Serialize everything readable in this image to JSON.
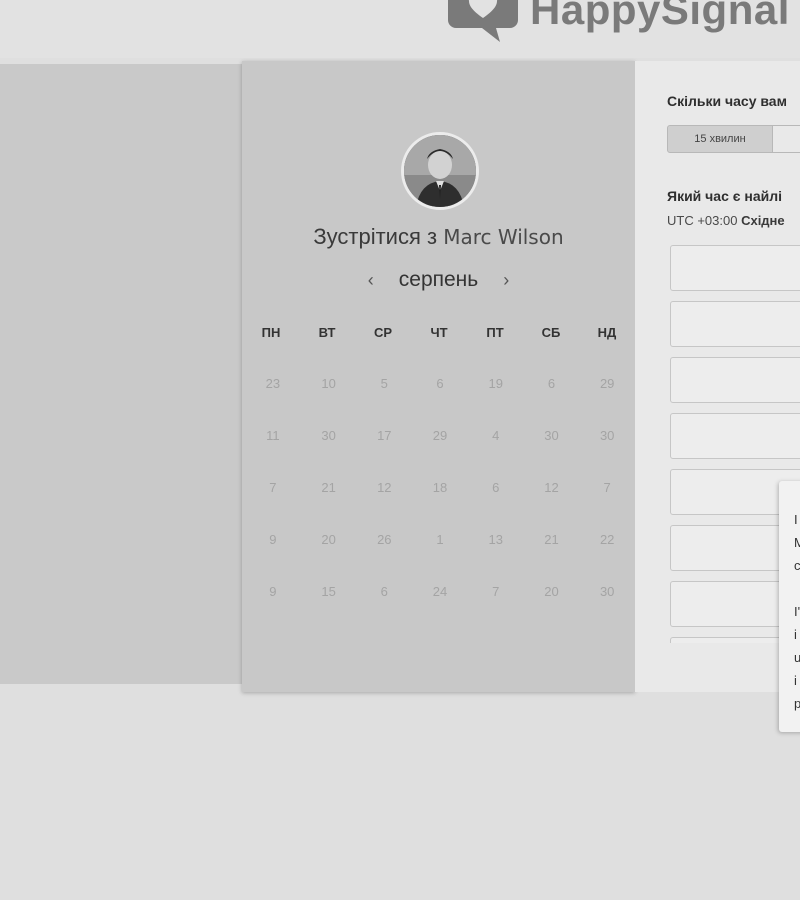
{
  "header": {
    "brand": "HappySignal",
    "logo_icon": "speech-bubble-heart-icon",
    "brand_color": "#7a7a7a"
  },
  "calendar": {
    "title_prefix": "Зустрітися з",
    "host_name": "Marc Wilson",
    "avatar": "user-avatar",
    "month": "серпень",
    "prev_icon": "chevron-left-icon",
    "next_icon": "chevron-right-icon",
    "weekdays": [
      "ПН",
      "ВТ",
      "СР",
      "ЧТ",
      "ПТ",
      "СБ",
      "НД"
    ],
    "weeks": [
      [
        "23",
        "10",
        "5",
        "6",
        "19",
        "6",
        "29"
      ],
      [
        "11",
        "30",
        "17",
        "29",
        "4",
        "30",
        "30"
      ],
      [
        "7",
        "21",
        "12",
        "18",
        "6",
        "12",
        "7"
      ],
      [
        "9",
        "20",
        "26",
        "1",
        "13",
        "21",
        "22"
      ],
      [
        "9",
        "15",
        "6",
        "24",
        "7",
        "20",
        "30"
      ]
    ]
  },
  "booking": {
    "duration_question": "Скільки часу вам",
    "duration_options": [
      "15 хвилин",
      ""
    ],
    "time_question": "Який час є найлі",
    "timezone_offset": "UTC +03:00",
    "timezone_name": "Східне",
    "slot_count_visible": 8
  },
  "popup": {
    "lines": [
      "I",
      "M",
      "c",
      "",
      "I'",
      "i",
      "u",
      "i",
      "p"
    ]
  }
}
